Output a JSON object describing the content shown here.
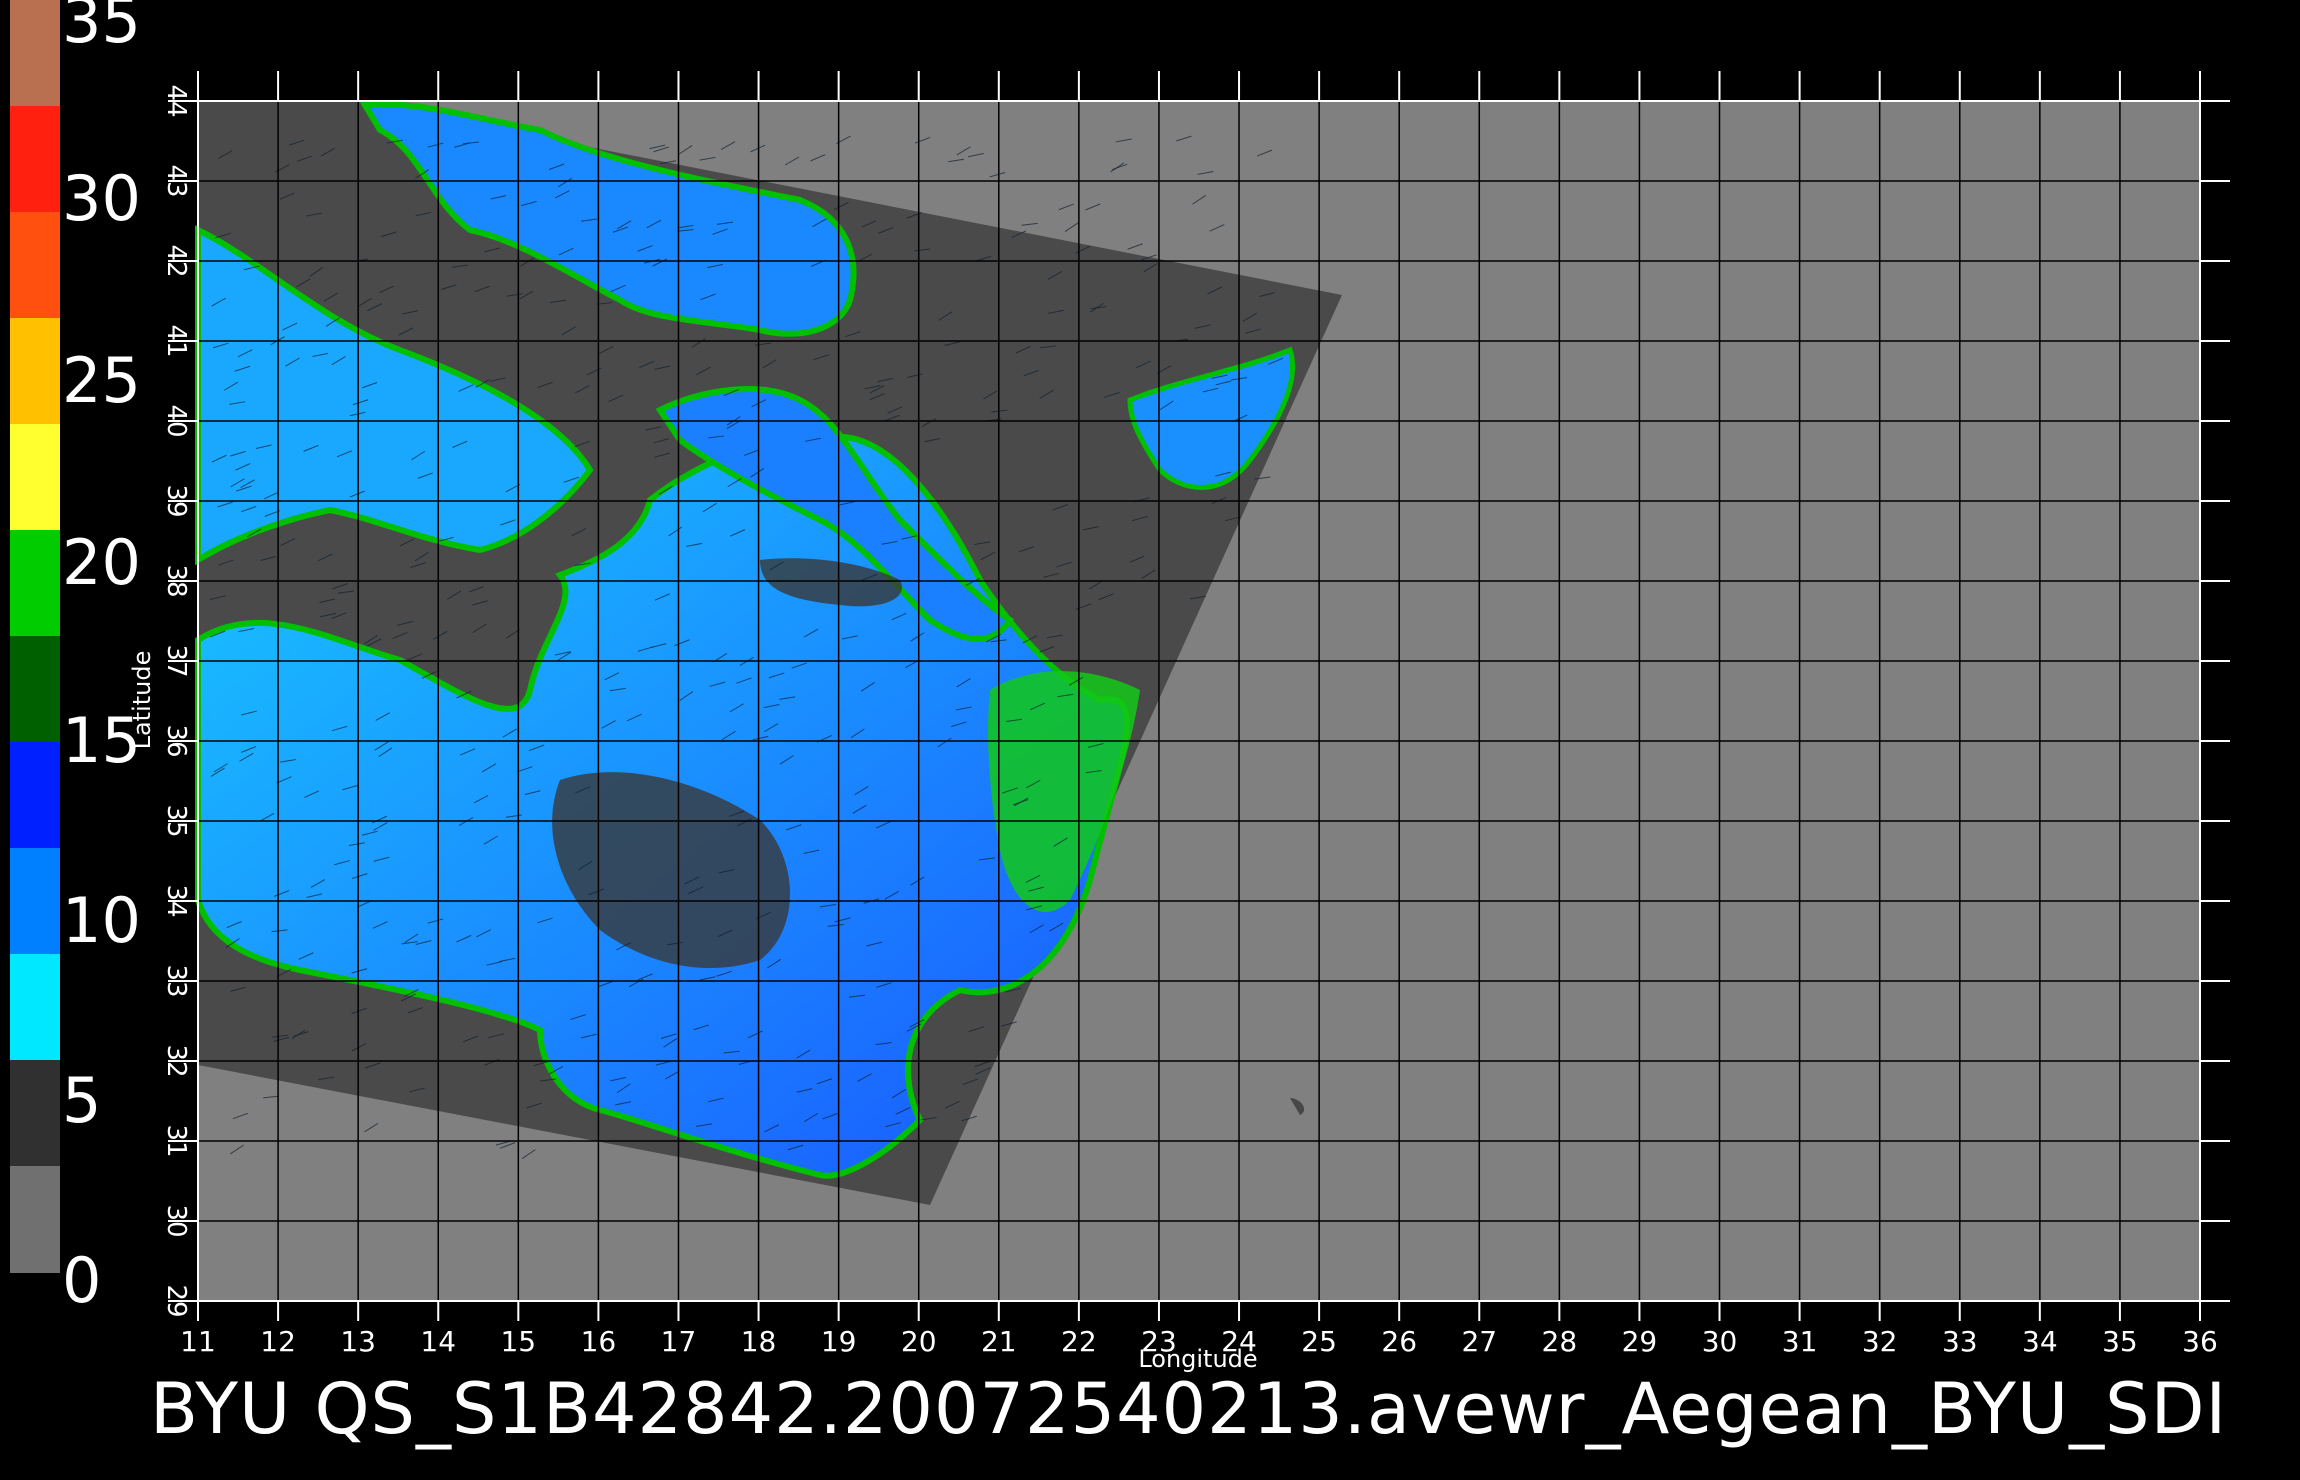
{
  "colorbar": {
    "labels": [
      "35",
      "30",
      "25",
      "20",
      "15",
      "10",
      "5",
      "0"
    ],
    "bands": [
      {
        "color": "#b87050"
      },
      {
        "color": "#ff2010"
      },
      {
        "color": "#ff5010"
      },
      {
        "color": "#ffc000"
      },
      {
        "color": "#ffff30"
      },
      {
        "color": "#00cc00"
      },
      {
        "color": "#006000"
      },
      {
        "color": "#0020ff"
      },
      {
        "color": "#0080ff"
      },
      {
        "color": "#00e8ff"
      },
      {
        "color": "#303030"
      },
      {
        "color": "#707070"
      }
    ]
  },
  "axes": {
    "xlabel": "Longitude",
    "ylabel": "Latitude",
    "x_ticks": [
      "11",
      "12",
      "13",
      "14",
      "15",
      "16",
      "17",
      "18",
      "19",
      "20",
      "21",
      "22",
      "23",
      "24",
      "25",
      "26",
      "27",
      "28",
      "29",
      "30",
      "31",
      "32",
      "33",
      "34",
      "35",
      "36"
    ],
    "y_ticks": [
      "29",
      "30",
      "31",
      "32",
      "33",
      "34",
      "35",
      "36",
      "37",
      "38",
      "39",
      "40",
      "41",
      "42",
      "43",
      "44"
    ]
  },
  "colors": {
    "background": "#000000",
    "map_bg": "#808080",
    "swath": "#4a4a4a",
    "grid": "#000000",
    "sea_core": "#1a6fff",
    "sea_light": "#18c8ff",
    "coast": "#00c000"
  },
  "caption": "BYU  QS_S1B42842.20072540213.avewr_Aegean_BYU_SDI"
}
